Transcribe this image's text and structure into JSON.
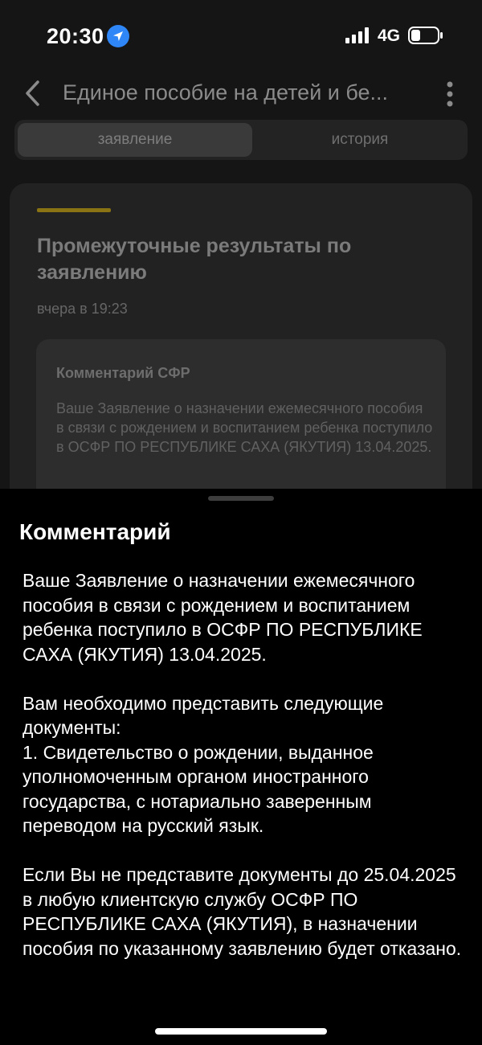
{
  "status_bar": {
    "time": "20:30",
    "network": "4G"
  },
  "header": {
    "title": "Единое пособие на детей и бе..."
  },
  "tabs": [
    {
      "label": "заявление",
      "active": true
    },
    {
      "label": "история",
      "active": false
    }
  ],
  "card": {
    "title": "Промежуточные результаты по заявлению",
    "date": "вчера в 19:23",
    "comment": {
      "title": "Комментарий СФР",
      "text": "Ваше Заявление о назначении ежемесячного пособия в связи с рождением и воспитанием ребенка поступило в ОСФР ПО РЕСПУБЛИКЕ САХА (ЯКУТИЯ) 13.04.2025."
    }
  },
  "sheet": {
    "title": "Комментарий",
    "paragraphs": [
      "Ваше Заявление о назначении ежемесячного пособия в связи с рождением и воспитанием ребенка поступило в ОСФР ПО РЕСПУБЛИКЕ САХА (ЯКУТИЯ) 13.04.2025.",
      "Вам необходимо представить следующие документы:\n1. Свидетельство о рождении, выданное уполномоченным органом иностранного государства, с нотариально заверенным переводом на русский язык.",
      "Если Вы не представите документы до 25.04.2025 в любую клиентскую службу ОСФР ПО РЕСПУБЛИКЕ САХА (ЯКУТИЯ), в назначении пособия по указанному заявлению будет отказано."
    ]
  },
  "colors": {
    "accent": "#8a7312",
    "location_badge": "#2f86f6"
  },
  "icons": [
    "location-arrow-icon",
    "signal-icon",
    "battery-icon",
    "back-chevron-icon",
    "more-vertical-icon"
  ]
}
